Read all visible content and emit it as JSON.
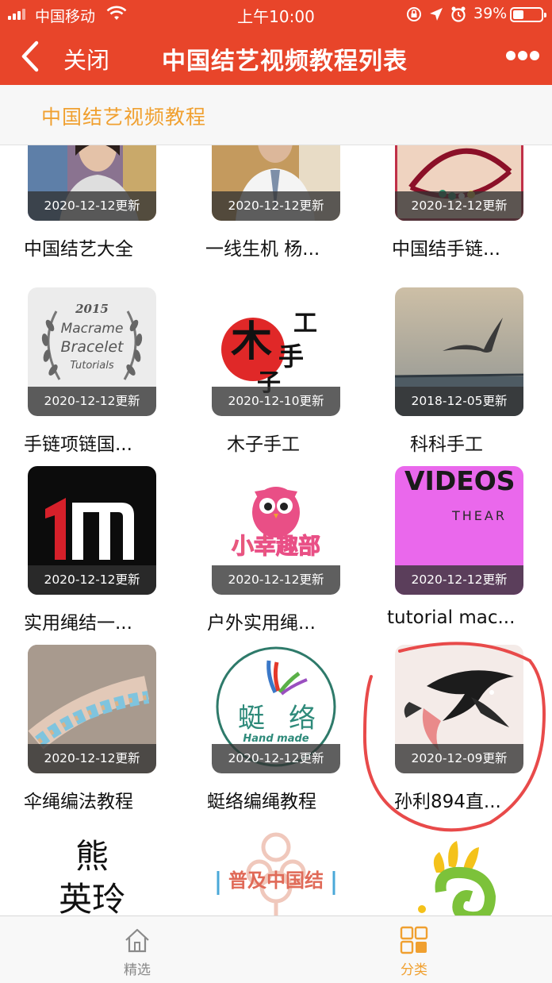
{
  "status_bar": {
    "carrier": "中国移动",
    "time": "上午10:00",
    "battery_percent": "39%",
    "battery_level": 0.39
  },
  "nav": {
    "close_label": "关闭",
    "title": "中国结艺视频教程列表"
  },
  "category": {
    "title": "中国结艺视频教程"
  },
  "items": [
    {
      "title": "中国结艺大全",
      "updated": "2020-12-12更新",
      "thumb_icon": "woman-presenter-photo"
    },
    {
      "title": "一线生机 杨...",
      "updated": "2020-12-12更新",
      "thumb_icon": "man-speaker-photo"
    },
    {
      "title": "中国结手链...",
      "updated": "2020-12-12更新",
      "thumb_icon": "bracelet-hand-photo"
    },
    {
      "title": "手链项链国...",
      "updated": "2020-12-12更新",
      "thumb_icon": "laurel-badge-logo",
      "thumb_text": [
        "2015",
        "Macrame",
        "Bracelet",
        "Tutorials"
      ]
    },
    {
      "title": "木子手工",
      "updated": "2020-12-10更新",
      "thumb_icon": "calligraphy-logo",
      "thumb_text": [
        "木",
        "子",
        "手",
        "工"
      ]
    },
    {
      "title": "科科手工",
      "updated": "2018-12-05更新",
      "thumb_icon": "seagull-photo"
    },
    {
      "title": "实用绳结一...",
      "updated": "2020-12-12更新",
      "thumb_icon": "letter-m-logo"
    },
    {
      "title": "户外实用绳...",
      "updated": "2020-12-12更新",
      "thumb_icon": "owl-logo",
      "thumb_text": [
        "小幸趣部"
      ]
    },
    {
      "title": "tutorial mac...",
      "updated": "2020-12-12更新",
      "thumb_icon": "videos-banner",
      "thumb_text": [
        "VIDEOS",
        "THEAR"
      ]
    },
    {
      "title": "伞绳编法教程",
      "updated": "2020-12-12更新",
      "thumb_icon": "paracord-bracelet-photo"
    },
    {
      "title": "蜓络编绳教程",
      "updated": "2020-12-12更新",
      "thumb_icon": "dragonfly-logo",
      "thumb_text": [
        "蜓",
        "络",
        "Hand made"
      ]
    },
    {
      "title": "孙利894直...",
      "updated": "2020-12-09更新",
      "thumb_icon": "ink-koi-painting"
    },
    {
      "title": "",
      "updated": "",
      "thumb_icon": "calligraphy-text",
      "thumb_text": [
        "熊",
        "英玲"
      ]
    },
    {
      "title": "",
      "updated": "",
      "thumb_icon": "chinese-knot-logo",
      "thumb_text": [
        "普及中国结"
      ]
    },
    {
      "title": "",
      "updated": "",
      "thumb_icon": "hand-logo"
    }
  ],
  "tabbar": {
    "home_label": "精选",
    "category_label": "分类",
    "active": "分类"
  },
  "colors": {
    "brand_red": "#e8452a",
    "accent_orange": "#f0a030",
    "annotation_red": "#e84a4a"
  }
}
